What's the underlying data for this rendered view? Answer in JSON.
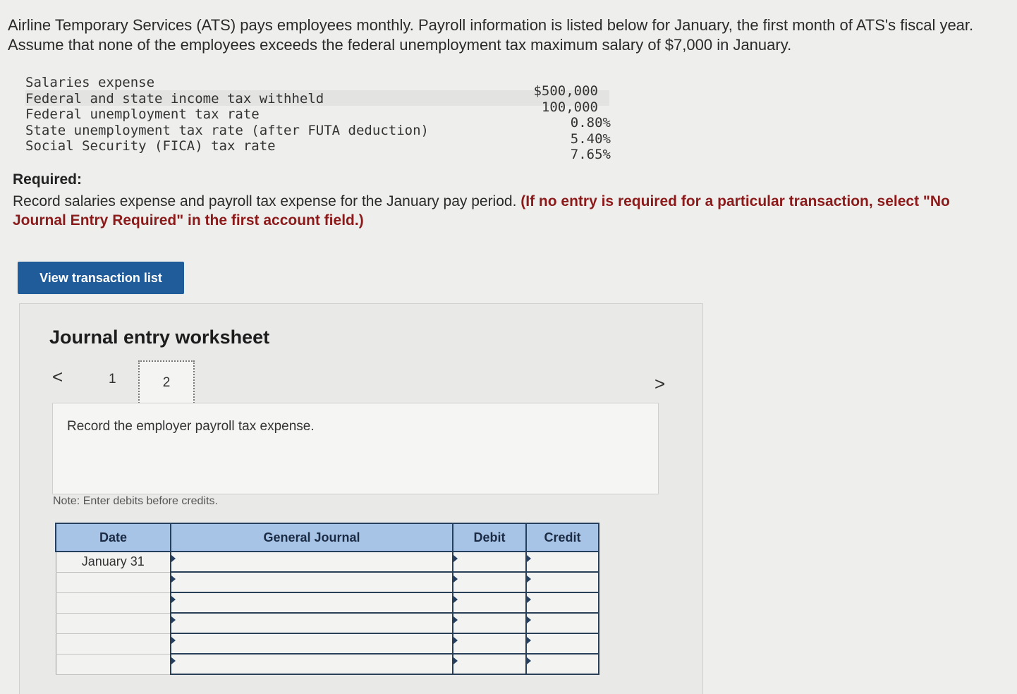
{
  "intro": {
    "text": "Airline Temporary Services (ATS) pays employees monthly. Payroll information is listed below for January, the first month of ATS's fiscal year. Assume that none of the employees exceeds the federal unemployment tax maximum salary of $7,000 in January."
  },
  "payroll_info": [
    {
      "label": "Salaries expense",
      "value": "$500,000"
    },
    {
      "label": "Federal and state income tax withheld",
      "value": "100,000"
    },
    {
      "label": "Federal unemployment tax rate",
      "value": "0.80%"
    },
    {
      "label": "State unemployment tax rate (after FUTA deduction)",
      "value": "5.40%"
    },
    {
      "label": "Social Security (FICA) tax rate",
      "value": "7.65%"
    }
  ],
  "required": {
    "title": "Required:",
    "text": "Record salaries expense and payroll tax expense for the January pay period.",
    "instruction": "(If no entry is required for a particular transaction, select \"No Journal Entry Required\" in the first account field.)"
  },
  "view_button": {
    "label": "View transaction list"
  },
  "worksheet": {
    "title": "Journal entry worksheet",
    "prev_arrow": "<",
    "next_arrow": ">",
    "steps": [
      "1",
      "2"
    ],
    "instruction": "Record the employer payroll tax expense.",
    "note": "Note: Enter debits before credits."
  },
  "journal": {
    "headers": {
      "date": "Date",
      "account": "General Journal",
      "debit": "Debit",
      "credit": "Credit"
    },
    "rows": [
      {
        "date": "January 31"
      },
      {
        "date": ""
      },
      {
        "date": ""
      },
      {
        "date": ""
      },
      {
        "date": ""
      },
      {
        "date": ""
      }
    ]
  }
}
